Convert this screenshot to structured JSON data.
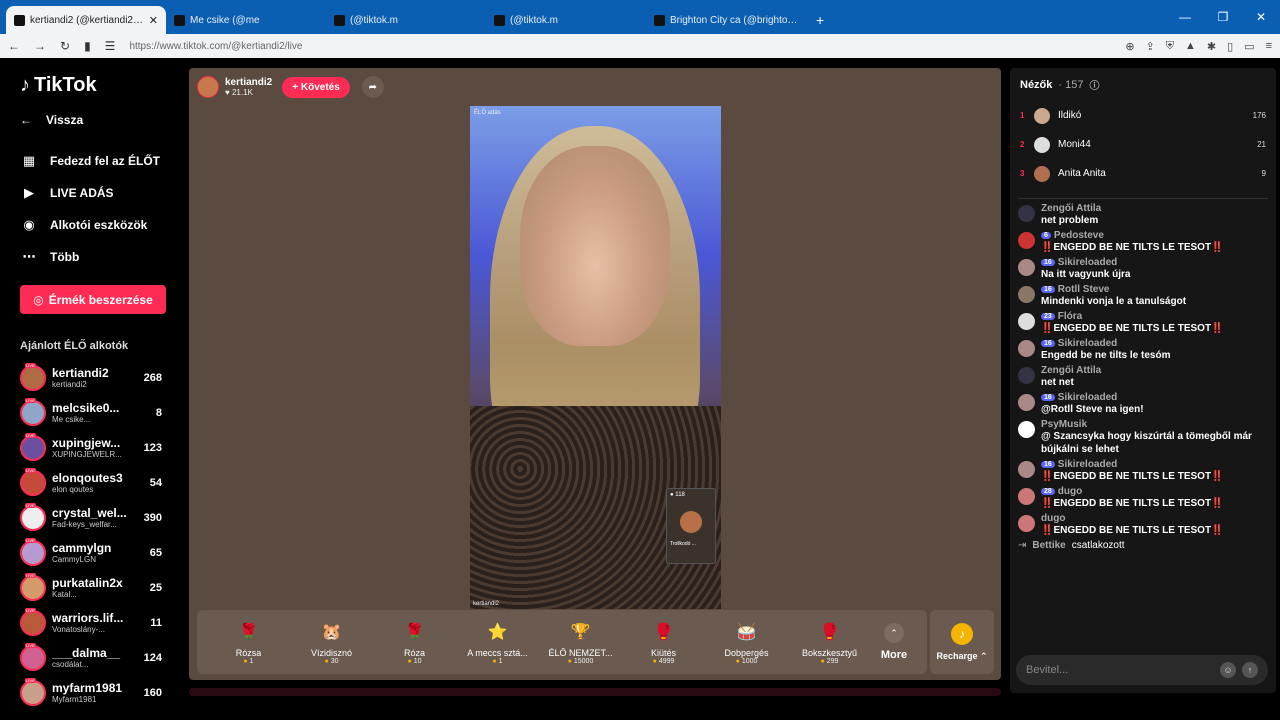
{
  "browser": {
    "tabs": [
      {
        "title": "kertiandi2 (@kertiandi2) ÉLŐ",
        "active": true
      },
      {
        "title": "Me csike (@me",
        "active": false
      },
      {
        "title": "(@tiktok.m",
        "active": false
      },
      {
        "title": "(@tiktok.m",
        "active": false
      },
      {
        "title": "Brighton City ca (@brighton.city) ÉLŐ",
        "active": false
      }
    ],
    "new_tab": "+",
    "url": "https://www.tiktok.com/@kertiandi2/live"
  },
  "sidebar": {
    "logo": "TikTok",
    "back_label": "Vissza",
    "nav": [
      {
        "label": "Fedezd fel az ÉLŐT",
        "icon": "calendar-icon"
      },
      {
        "label": "LIVE ADÁS",
        "icon": "video-icon"
      },
      {
        "label": "Alkotói eszközök",
        "icon": "lightbulb-icon"
      },
      {
        "label": "Több",
        "icon": "more-icon"
      }
    ],
    "coins_button": "Érmék beszerzése",
    "recommended_title": "Ajánlott ÉLŐ alkotók",
    "creators": [
      {
        "name": "kertiandi2",
        "sub": "kertiandi2",
        "count": "268",
        "color": "#b06a44"
      },
      {
        "name": "melcsike0...",
        "sub": "Me csike...",
        "count": "8",
        "color": "#8fa6c8"
      },
      {
        "name": "xupingjew...",
        "sub": "XUPINGJEWELR...",
        "count": "123",
        "color": "#6a4fa0"
      },
      {
        "name": "elonqoutes3",
        "sub": "elon qoutes",
        "count": "54",
        "color": "#c44a3a"
      },
      {
        "name": "crystal_wel...",
        "sub": "Fad-keys_welfar...",
        "count": "390",
        "color": "#eee"
      },
      {
        "name": "cammylgn",
        "sub": "CammyLGN",
        "count": "65",
        "color": "#b59bd0"
      },
      {
        "name": "purkatalin2x",
        "sub": "Katal...",
        "count": "25",
        "color": "#d49a6a"
      },
      {
        "name": "warriors.lif...",
        "sub": "Vonatoslány-...",
        "count": "11",
        "color": "#b85a3a"
      },
      {
        "name": "___dalma__",
        "sub": "csodálat...",
        "count": "124",
        "color": "#d06090"
      },
      {
        "name": "myfarm1981",
        "sub": "Myfarm1981",
        "count": "160",
        "color": "#c8a08a"
      }
    ]
  },
  "stage": {
    "host_name": "kertiandi2",
    "host_likes": "21.1K",
    "follow_label": "+ Követés",
    "video_label": "ÉLŐ adás",
    "video_footer": "kertiandi2",
    "guest_viewers": "118",
    "guest_name": "Trollkodó ..."
  },
  "gifts": [
    {
      "name": "Rózsa",
      "price": "1",
      "emoji": "🌹"
    },
    {
      "name": "Vízidisznó",
      "price": "30",
      "emoji": "🐹"
    },
    {
      "name": "Róza",
      "price": "10",
      "emoji": "🌹"
    },
    {
      "name": "A meccs sztá...",
      "price": "1",
      "emoji": "⭐"
    },
    {
      "name": "ÉLŐ NEMZET...",
      "price": "15000",
      "emoji": "🏆"
    },
    {
      "name": "Kiütés",
      "price": "4999",
      "emoji": "🥊"
    },
    {
      "name": "Dobpergés",
      "price": "1000",
      "emoji": "🥁"
    },
    {
      "name": "Bokszkesztyű",
      "price": "299",
      "emoji": "🥊"
    }
  ],
  "more_label": "More",
  "recharge_label": "Recharge",
  "panel": {
    "viewers_label": "Nézők",
    "viewers_count": "· 157",
    "top_viewers": [
      {
        "rank": "1",
        "name": "Ildikó",
        "score": "176",
        "color": "#c9a890"
      },
      {
        "rank": "2",
        "name": "Moni44",
        "score": "21",
        "color": "#ddd"
      },
      {
        "rank": "3",
        "name": "Anita Anita",
        "score": "9",
        "color": "#b07050"
      }
    ],
    "messages": [
      {
        "user": "Zengői Attila",
        "text": "net problem",
        "badge": "",
        "color": "#334"
      },
      {
        "user": "Pedosteve",
        "text": "‼️ENGEDD BE NE TILTS LE TESOT‼️",
        "badge": "6",
        "color": "#c33"
      },
      {
        "user": "Sikireloaded",
        "text": "Na itt vagyunk újra",
        "badge": "16",
        "color": "#a88"
      },
      {
        "user": "Rotll Steve",
        "text": "Mindenki vonja le a tanulságot",
        "badge": "16",
        "color": "#876"
      },
      {
        "user": "Flóra",
        "text": "‼️ENGEDD BE NE TILTS LE TESOT‼️",
        "badge": "23",
        "color": "#ddd"
      },
      {
        "user": "Sikireloaded",
        "text": "Engedd be ne tilts le tesóm",
        "badge": "16",
        "color": "#a88"
      },
      {
        "user": "Zengői Attila",
        "text": "net net",
        "badge": "",
        "color": "#334"
      },
      {
        "user": "Sikireloaded",
        "text": "@Rotll Steve na igen!",
        "badge": "16",
        "color": "#a88"
      },
      {
        "user": "PsyMusik",
        "text": "@ Szancsyka hogy kiszúrtál a tömegből már bújkálni se lehet",
        "badge": "",
        "color": "#fff"
      },
      {
        "user": "Sikireloaded",
        "text": "‼️ENGEDD BE NE TILTS LE TESOT‼️",
        "badge": "16",
        "color": "#a88"
      },
      {
        "user": "dugo",
        "text": "‼️ENGEDD BE NE TILTS LE TESOT‼️",
        "badge": "28",
        "color": "#c77"
      },
      {
        "user": "dugo",
        "text": "‼️ENGEDD BE NE TILTS LE TESOT‼️",
        "badge": "",
        "color": "#c77"
      }
    ],
    "joined_user": "Bettike",
    "joined_text": "csatlakozott",
    "input_placeholder": "Bevitel..."
  }
}
